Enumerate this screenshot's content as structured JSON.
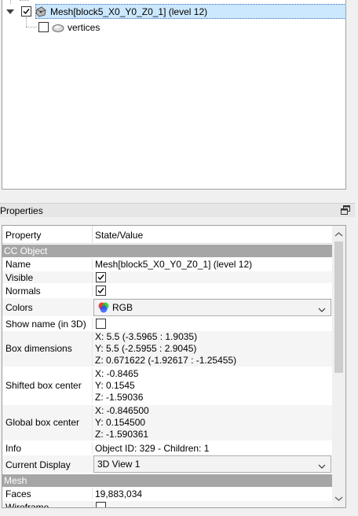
{
  "tree": {
    "mesh_label": "Mesh[block5_X0_Y0_Z0_1] (level 12)",
    "vertices_label": "vertices",
    "mesh_checked": true,
    "vertices_checked": false
  },
  "dock": {
    "title": "Properties"
  },
  "table": {
    "col_property": "Property",
    "col_value": "State/Value",
    "section_cc": "CC Object",
    "section_mesh": "Mesh",
    "rows": {
      "name": {
        "key": "Name",
        "value": "Mesh[block5_X0_Y0_Z0_1] (level 12)"
      },
      "visible": {
        "key": "Visible",
        "checked": true
      },
      "normals": {
        "key": "Normals",
        "checked": true
      },
      "colors": {
        "key": "Colors",
        "value": "RGB"
      },
      "show_name": {
        "key": "Show name (in 3D)",
        "checked": false
      },
      "box_dim": {
        "key": "Box dimensions",
        "x": "X: 5.5 (-3.5965 : 1.9035)",
        "y": "Y: 5.5 (-2.5955 : 2.9045)",
        "z": "Z: 0.671622 (-1.92617 : -1.25455)"
      },
      "shifted": {
        "key": "Shifted box center",
        "x": "X: -0.8465",
        "y": "Y: 0.1545",
        "z": "Z: -1.59036"
      },
      "global": {
        "key": "Global box center",
        "x": "X: -0.846500",
        "y": "Y: 0.154500",
        "z": "Z: -1.590361"
      },
      "info": {
        "key": "Info",
        "value": "Object ID: 329 - Children: 1"
      },
      "display": {
        "key": "Current Display",
        "value": "3D View 1"
      },
      "faces": {
        "key": "Faces",
        "value": "19,883,034"
      },
      "wireframe": {
        "key": "Wireframe",
        "checked": false
      }
    }
  },
  "colors": {
    "selection": "#cce8ff",
    "section": "#a6a6a6",
    "alt_row": "#f5f5f5"
  }
}
